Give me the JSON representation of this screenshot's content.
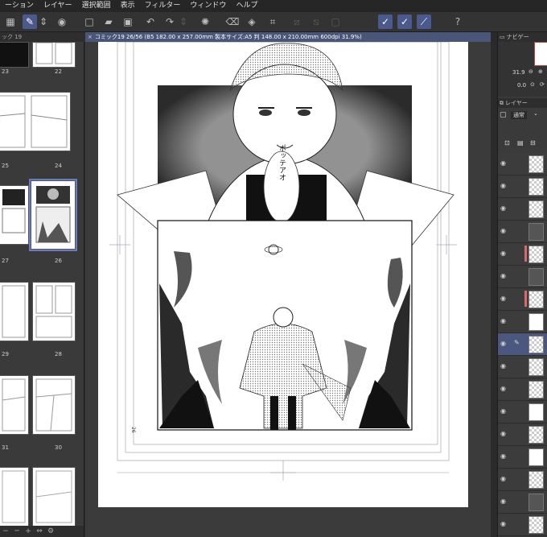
{
  "menu": [
    "ーション",
    "レイヤー",
    "選択範囲",
    "表示",
    "フィルター",
    "ウィンドウ",
    "ヘルプ"
  ],
  "toolbar_icons": [
    "transparency-icon",
    "edit-icon",
    "stepper-icon",
    "record-icon",
    "new-page-icon",
    "open-folder-icon",
    "save-icon",
    "undo-icon",
    "redo-icon",
    "stepper-icon",
    "loading-icon",
    "clear-icon",
    "fill-icon",
    "crop-icon",
    "transform-icon",
    "transform-icon",
    "transform-icon",
    "pen-icon",
    "pen-icon",
    "brush-icon",
    "help-icon"
  ],
  "left_panel": {
    "tab": "ック 19",
    "pages": [
      "23",
      "22",
      "25",
      "24",
      "27",
      "26",
      "29",
      "28",
      "31",
      "30"
    ],
    "selected_page": "26"
  },
  "document_tab": {
    "close": "×",
    "title": "コミック19 26/56 (B5 182.00 x 257.00mm 製本サイズ:A5 判 148.00 x 210.00mm 600dpi 31.9%)"
  },
  "canvas": {
    "sfx_text": "ポッテアオ",
    "page_number": "26"
  },
  "right_panel": {
    "navigator_label": "ナビゲー",
    "zoom_value": "31.9",
    "rotate_value": "0.0",
    "layers_label": "レイヤー",
    "blend_mode": "通常"
  },
  "colors": {
    "menubar": "#262626",
    "toolbar": "#333333",
    "panel": "#3a3a3a",
    "accent": "#4a5678",
    "selection": "#6a7cc0",
    "red_marker": "#d86a6a"
  }
}
